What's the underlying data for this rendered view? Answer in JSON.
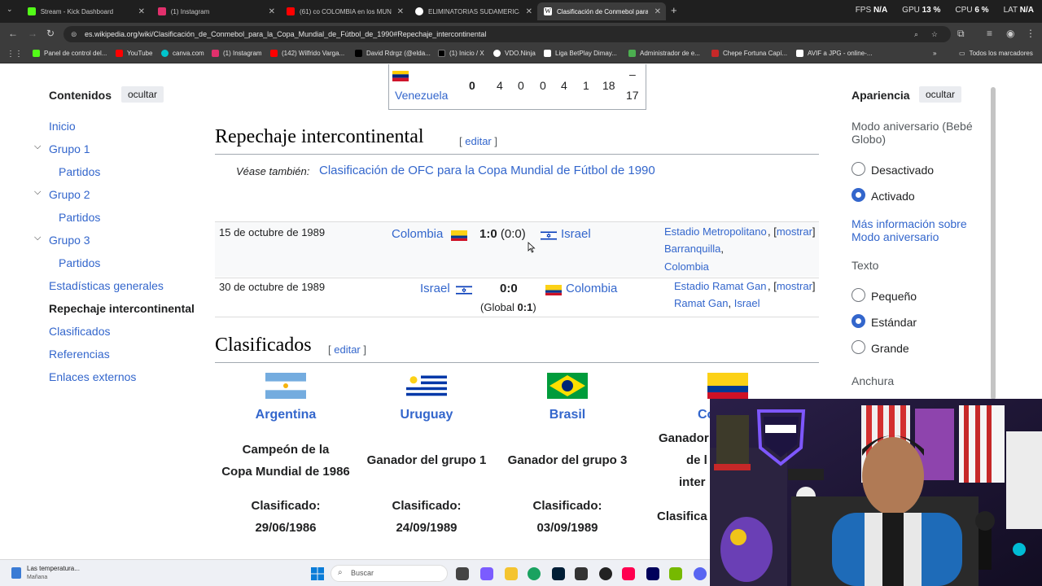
{
  "browser": {
    "tabs": [
      {
        "title": "Stream - Kick Dashboard",
        "color": "#53fc18"
      },
      {
        "title": "(1) Instagram",
        "color": "#e1306c"
      },
      {
        "title": "(61) co COLOMBIA en los MUN",
        "color": "#ff0000"
      },
      {
        "title": "ELIMINATORIAS SUDAMERICanas",
        "color": "#ffffff"
      },
      {
        "title": "Clasificación de Conmebol para",
        "color": "#ffffff"
      }
    ],
    "perf": {
      "fps_label": "FPS",
      "fps_value": "N/A",
      "gpu_label": "GPU",
      "gpu_value": "13 %",
      "cpu_label": "CPU",
      "cpu_value": "6 %",
      "lat_label": "LAT",
      "lat_value": "N/A"
    },
    "url": "es.wikipedia.org/wiki/Clasificación_de_Conmebol_para_la_Copa_Mundial_de_Fútbol_de_1990#Repechaje_intercontinental",
    "bookmarks": [
      {
        "label": "Panel de control del...",
        "color": "#53fc18"
      },
      {
        "label": "YouTube",
        "color": "#ff0000"
      },
      {
        "label": "canva.com",
        "color": "#00c4cc"
      },
      {
        "label": "(1) Instagram",
        "color": "#e1306c"
      },
      {
        "label": "(142) Wilfrido Varga...",
        "color": "#ff0000"
      },
      {
        "label": "David Rdrgz (@elda...",
        "color": "#000000"
      },
      {
        "label": "(1) Inicio / X",
        "color": "#000000"
      },
      {
        "label": "VDO.Ninja",
        "color": "#ffffff"
      },
      {
        "label": "Liga BetPlay Dimay...",
        "color": "#ffffff"
      },
      {
        "label": "Administrador de e...",
        "color": "#4caf50"
      },
      {
        "label": "Chepe Fortuna Capí...",
        "color": "#c62828"
      },
      {
        "label": "AVIF a JPG - online-...",
        "color": "#ffffff"
      }
    ],
    "bookmarks_folder": "Todos los marcadores"
  },
  "toc": {
    "title": "Contenidos",
    "hide": "ocultar",
    "items": [
      "Inicio",
      "Grupo 1",
      "Partidos",
      "Grupo 2",
      "Partidos",
      "Grupo 3",
      "Partidos",
      "Estadísticas generales",
      "Repechaje intercontinental",
      "Clasificados",
      "Referencias",
      "Enlaces externos"
    ]
  },
  "standings_row": {
    "team": "Venezuela",
    "pts": "0",
    "pj": "4",
    "pg": "0",
    "pe": "0",
    "pp": "4",
    "gf": "1",
    "gc": "18",
    "dif_top": "–",
    "dif_bottom": "17"
  },
  "repechaje": {
    "heading": "Repechaje intercontinental",
    "edit": "editar",
    "see_also_prefix": "Véase también:",
    "see_also_link": "Clasificación de OFC para la Copa Mundial de Fútbol de 1990",
    "matches": [
      {
        "date": "15 de octubre de 1989",
        "home": "Colombia",
        "score": "1:0",
        "score_ht": "(0:0)",
        "away": "Israel",
        "stadium": "Estadio Metropolitano",
        "city": "Barranquilla",
        "country": "Colombia",
        "show": "mostrar"
      },
      {
        "date": "30 de octubre de 1989",
        "home": "Israel",
        "score": "0:0",
        "aggregate_prefix": "(Global",
        "aggregate": "0:1",
        "aggregate_suffix": ")",
        "away": "Colombia",
        "stadium": "Estadio Ramat Gan",
        "city": "Ramat Gan",
        "country": "Israel",
        "show": "mostrar"
      }
    ]
  },
  "clasificados": {
    "heading": "Clasificados",
    "edit": "editar",
    "teams": [
      {
        "name": "Argentina",
        "desc1": "Campeón de la",
        "desc2": "Copa Mundial de 1986",
        "qlabel": "Clasificado:",
        "qdate": "29/06/1986"
      },
      {
        "name": "Uruguay",
        "desc1": "Ganador del grupo 1",
        "qlabel": "Clasificado:",
        "qdate": "24/09/1989"
      },
      {
        "name": "Brasil",
        "desc1": "Ganador del grupo 3",
        "qlabel": "Clasificado:",
        "qdate": "03/09/1989"
      },
      {
        "name": "Co",
        "desc1": "Ganador",
        "desc2": "de l",
        "desc3": "inter",
        "qlabel": "Clasifica"
      }
    ]
  },
  "appearance": {
    "title": "Apariencia",
    "hide": "ocultar",
    "anniversary_label": "Modo aniversario (Bebé Globo)",
    "opt_off": "Desactivado",
    "opt_on": "Activado",
    "more_info": "Más información sobre Modo aniversario",
    "text_label": "Texto",
    "text_small": "Pequeño",
    "text_standard": "Estándar",
    "text_large": "Grande",
    "width_label": "Anchura"
  },
  "taskbar": {
    "weather_title": "Las temperatura...",
    "weather_sub": "Mañana",
    "search": "Buscar"
  },
  "colors": {
    "link": "#3366cc",
    "accent": "#3366cc"
  }
}
